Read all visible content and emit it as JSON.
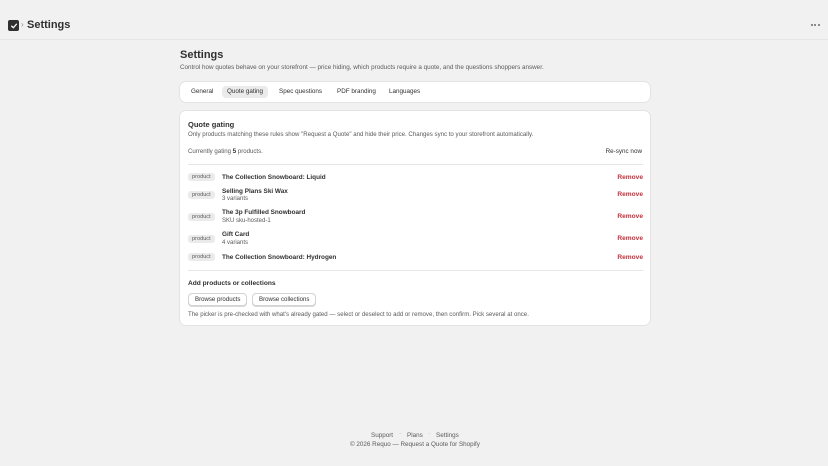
{
  "topbar": {
    "title": "Settings",
    "app_icon": "check-square-icon",
    "more_icon": "more-horizontal-icon"
  },
  "header": {
    "title": "Settings",
    "subtitle": "Control how quotes behave on your storefront — price hiding, which products require a quote, and the questions shoppers answer."
  },
  "tabs": [
    {
      "label": "General"
    },
    {
      "label": "Quote gating",
      "active": true
    },
    {
      "label": "Spec questions"
    },
    {
      "label": "PDF branding"
    },
    {
      "label": "Languages"
    }
  ],
  "quote_gating": {
    "title": "Quote gating",
    "description": "Only products matching these rules show \"Request a Quote\" and hide their price. Changes sync to your storefront automatically.",
    "count_prefix": "Currently gating ",
    "count": "5",
    "count_suffix": " products.",
    "resync_label": "Re-sync now",
    "remove_label": "Remove",
    "items": [
      {
        "type": "product",
        "title": "The Collection Snowboard: Liquid",
        "subtitle": ""
      },
      {
        "type": "product",
        "title": "Selling Plans Ski Wax",
        "subtitle": "3 variants"
      },
      {
        "type": "product",
        "title": "The 3p Fulfilled Snowboard",
        "subtitle": "SKU sku-hosted-1"
      },
      {
        "type": "product",
        "title": "Gift Card",
        "subtitle": "4 variants"
      },
      {
        "type": "product",
        "title": "The Collection Snowboard: Hydrogen",
        "subtitle": ""
      }
    ],
    "add_title": "Add products or collections",
    "browse_products": "Browse products",
    "browse_collections": "Browse collections",
    "hint": "The picker is pre-checked with what's already gated — select or deselect to add or remove, then confirm. Pick several at once."
  },
  "footer": {
    "links": [
      "Support",
      "Plans",
      "Settings"
    ],
    "separator": "·",
    "copyright": "© 2026 Requo — Request a Quote for Shopify"
  },
  "colors": {
    "danger": "#c5303c",
    "background": "#f1f1f1",
    "card": "#ffffff"
  }
}
